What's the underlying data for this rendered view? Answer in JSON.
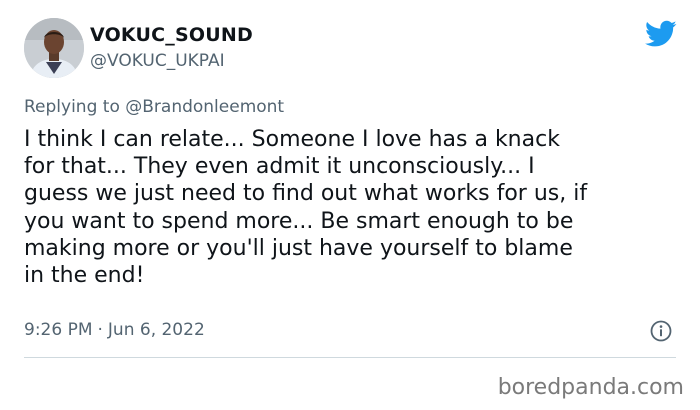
{
  "author": {
    "display_name": "VOKUC_SOUND",
    "handle": "@VOKUC_UKPAI",
    "avatar_icon": "user-photo-avatar"
  },
  "reply": {
    "prefix": "Replying to",
    "to_handle": "@Brandonleemont"
  },
  "tweet": {
    "lines": [
      "I think I can relate... Someone I love has a knack",
      "for that... They even admit it unconsciously... I",
      "guess we just need to find out what works for us, if",
      "you want to spend more... Be smart enough to be",
      "making more or you'll just have yourself to blame",
      "in the end!"
    ]
  },
  "meta": {
    "time": "9:26 PM",
    "separator": "·",
    "date": "Jun 6, 2022"
  },
  "icons": {
    "brand": "twitter-bird-icon",
    "info": "info-icon"
  },
  "colors": {
    "brand_blue": "#1d9bf0",
    "secondary_text": "#536471",
    "mention_text": "#536471"
  },
  "watermark": {
    "text": "boredpanda.com"
  }
}
